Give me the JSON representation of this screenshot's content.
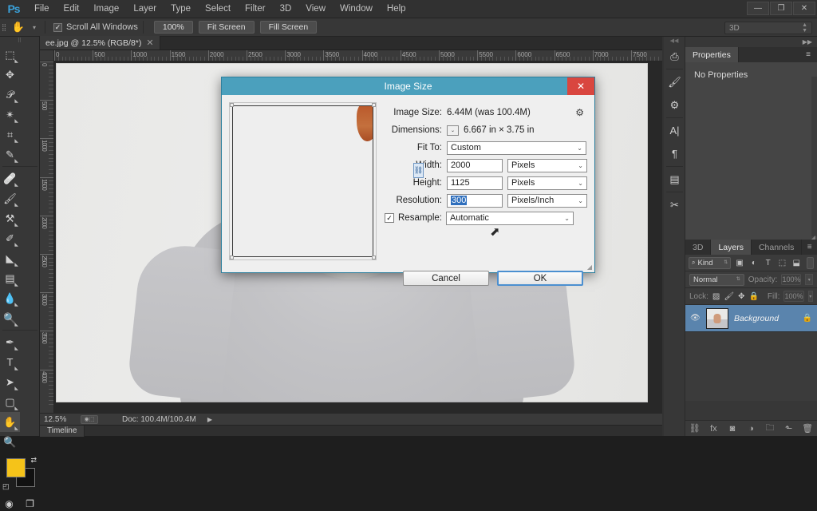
{
  "app": {
    "logo": "Ps",
    "menus": [
      "File",
      "Edit",
      "Image",
      "Layer",
      "Type",
      "Select",
      "Filter",
      "3D",
      "View",
      "Window",
      "Help"
    ],
    "window_controls": {
      "minimize": "—",
      "maximize": "❐",
      "close": "✕"
    }
  },
  "options_bar": {
    "tool_icon": "hand-tool",
    "tool_glyph": "✋",
    "caret": "▾",
    "checkbox_label": "Scroll All Windows",
    "checkbox_checked": true,
    "check_glyph": "✓",
    "buttons": [
      "100%",
      "Fit Screen",
      "Fill Screen"
    ],
    "workspace": "3D"
  },
  "toolbar": {
    "tools": [
      {
        "name": "marquee-tool",
        "glyph": "⬚"
      },
      {
        "name": "move-tool",
        "glyph": "✥"
      },
      {
        "name": "lasso-tool",
        "glyph": "𝒫"
      },
      {
        "name": "quick-selection-tool",
        "glyph": "✴"
      },
      {
        "name": "crop-tool",
        "glyph": "⌗"
      },
      {
        "name": "eyedropper-tool",
        "glyph": "✎"
      },
      {
        "name": "healing-brush-tool",
        "glyph": "🩹"
      },
      {
        "name": "brush-tool",
        "glyph": "🖌"
      },
      {
        "name": "clone-stamp-tool",
        "glyph": "⚒"
      },
      {
        "name": "history-brush-tool",
        "glyph": "✐"
      },
      {
        "name": "eraser-tool",
        "glyph": "◣"
      },
      {
        "name": "gradient-tool",
        "glyph": "▤"
      },
      {
        "name": "blur-tool",
        "glyph": "💧"
      },
      {
        "name": "dodge-tool",
        "glyph": "🔍"
      },
      {
        "name": "pen-tool",
        "glyph": "✒"
      },
      {
        "name": "type-tool",
        "glyph": "T"
      },
      {
        "name": "path-selection-tool",
        "glyph": "➤"
      },
      {
        "name": "rectangle-tool",
        "glyph": "▢"
      },
      {
        "name": "hand-tool",
        "glyph": "✋",
        "active": true
      },
      {
        "name": "zoom-tool",
        "glyph": "🔍"
      }
    ],
    "foreground_color": "#f5c319",
    "background_color": "#111111",
    "swap_glyph": "⇄",
    "default_glyph": "◰",
    "quick_mask_glyph": "◉",
    "screen_mode_glyph": "❐"
  },
  "document": {
    "tab_label": "ee.jpg @ 12.5% (RGB/8*)",
    "tab_close": "✕",
    "ruler_h_labels": [
      "0",
      "500",
      "1000",
      "1500",
      "2000",
      "2500",
      "3000",
      "3500",
      "4000",
      "4500",
      "5000",
      "5500",
      "6000",
      "6500",
      "7000",
      "7500"
    ],
    "ruler_v_labels": [
      "0",
      "500",
      "1000",
      "1500",
      "2000",
      "2500",
      "3000",
      "3500",
      "4000"
    ]
  },
  "status_bar": {
    "zoom": "12.5%",
    "doc_info": "Doc: 100.4M/100.4M",
    "arrow": "▶",
    "timeline_tab": "Timeline"
  },
  "dock_strip": {
    "collapse_left": "◀◀",
    "collapse_right": "▶▶",
    "icons": [
      {
        "name": "history-icon",
        "glyph": "⎙"
      },
      {
        "name": "brush-presets-icon",
        "glyph": "🖌"
      },
      {
        "name": "adjustments-icon",
        "glyph": "⚙"
      },
      {
        "name": "character-icon",
        "glyph": "A|"
      },
      {
        "name": "paragraph-icon",
        "glyph": "¶"
      },
      {
        "name": "styles-icon",
        "glyph": "▤"
      },
      {
        "name": "tool-presets-icon",
        "glyph": "✂"
      }
    ]
  },
  "properties_panel": {
    "tab": "Properties",
    "menu_glyph": "≡",
    "empty_text": "No Properties"
  },
  "layers_panel": {
    "tabs": [
      "3D",
      "Layers",
      "Channels"
    ],
    "active_tab": "Layers",
    "menu_glyph": "≡",
    "filter": {
      "kind_label": "Kind",
      "search_glyph": "🔍",
      "arrows": "⇅",
      "icons": [
        "▣",
        "◐",
        "T",
        "⬚",
        "⬓"
      ]
    },
    "blend_mode": "Normal",
    "opacity_label": "Opacity:",
    "opacity_value": "100%",
    "lock_label": "Lock:",
    "lock_icons": [
      "▨",
      "🖌",
      "✥",
      "🔒"
    ],
    "fill_label": "Fill:",
    "fill_value": "100%",
    "layer": {
      "eye_glyph": "👁",
      "name": "Background",
      "lock_glyph": "🔒"
    },
    "footer_icons": [
      {
        "name": "link-layers-icon",
        "glyph": "⛓"
      },
      {
        "name": "layer-style-icon",
        "glyph": "fx"
      },
      {
        "name": "layer-mask-icon",
        "glyph": "◙"
      },
      {
        "name": "adjustment-layer-icon",
        "glyph": "◑"
      },
      {
        "name": "new-group-icon",
        "glyph": "🗀"
      },
      {
        "name": "new-layer-icon",
        "glyph": "⬑"
      },
      {
        "name": "delete-layer-icon",
        "glyph": "🗑"
      }
    ]
  },
  "dialog": {
    "title": "Image Size",
    "close_glyph": "✕",
    "gear_glyph": "⚙",
    "image_size_label": "Image Size:",
    "image_size_value": "6.44M (was 100.4M)",
    "dimensions_label": "Dimensions:",
    "dimensions_value": "6.667 in  ×  3.75 in",
    "fit_to_label": "Fit To:",
    "fit_to_value": "Custom",
    "width_label": "Width:",
    "width_value": "2000",
    "width_unit": "Pixels",
    "height_label": "Height:",
    "height_value": "1125",
    "height_unit": "Pixels",
    "resolution_label": "Resolution:",
    "resolution_value": "300",
    "resolution_unit": "Pixels/Inch",
    "resample_label": "Resample:",
    "resample_checked": true,
    "resample_value": "Automatic",
    "check_glyph": "✓",
    "chain_glyph": "⛓",
    "caret": "⌄",
    "cancel_label": "Cancel",
    "ok_label": "OK",
    "resize_glyph": "◢",
    "cursor_glyph": "⬈"
  }
}
